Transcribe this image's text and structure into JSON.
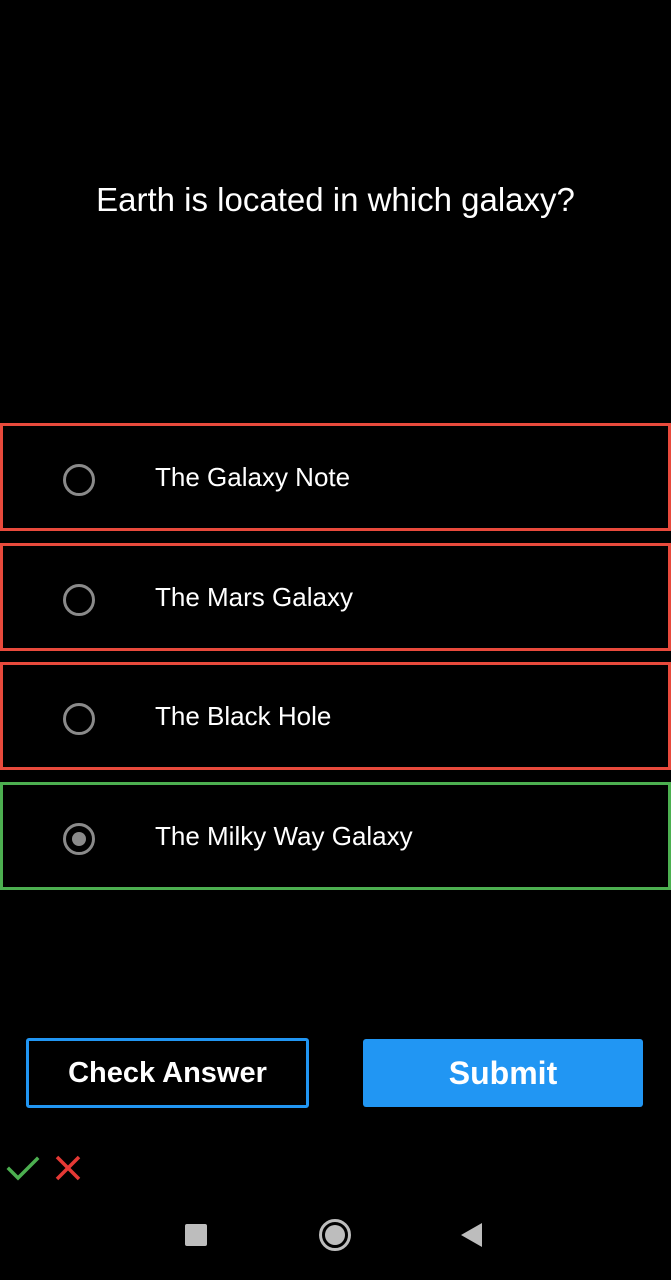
{
  "question": {
    "text": "Earth is located in which galaxy?"
  },
  "options": [
    {
      "label": "The Galaxy Note",
      "selected": false,
      "status": "incorrect"
    },
    {
      "label": "The Mars Galaxy",
      "selected": false,
      "status": "incorrect"
    },
    {
      "label": "The Black Hole",
      "selected": false,
      "status": "incorrect"
    },
    {
      "label": "The Milky Way Galaxy",
      "selected": true,
      "status": "correct"
    }
  ],
  "buttons": {
    "check_answer": "Check Answer",
    "submit": "Submit"
  },
  "score_icons": [
    "check-icon",
    "cross-icon"
  ],
  "nav_icons": [
    "recents-square-icon",
    "home-circle-icon",
    "back-triangle-icon"
  ],
  "colors": {
    "background": "#000000",
    "incorrect_border": "#e84a3c",
    "correct_border": "#4caf50",
    "accent": "#2196f3",
    "radio": "#8a8a8a"
  }
}
